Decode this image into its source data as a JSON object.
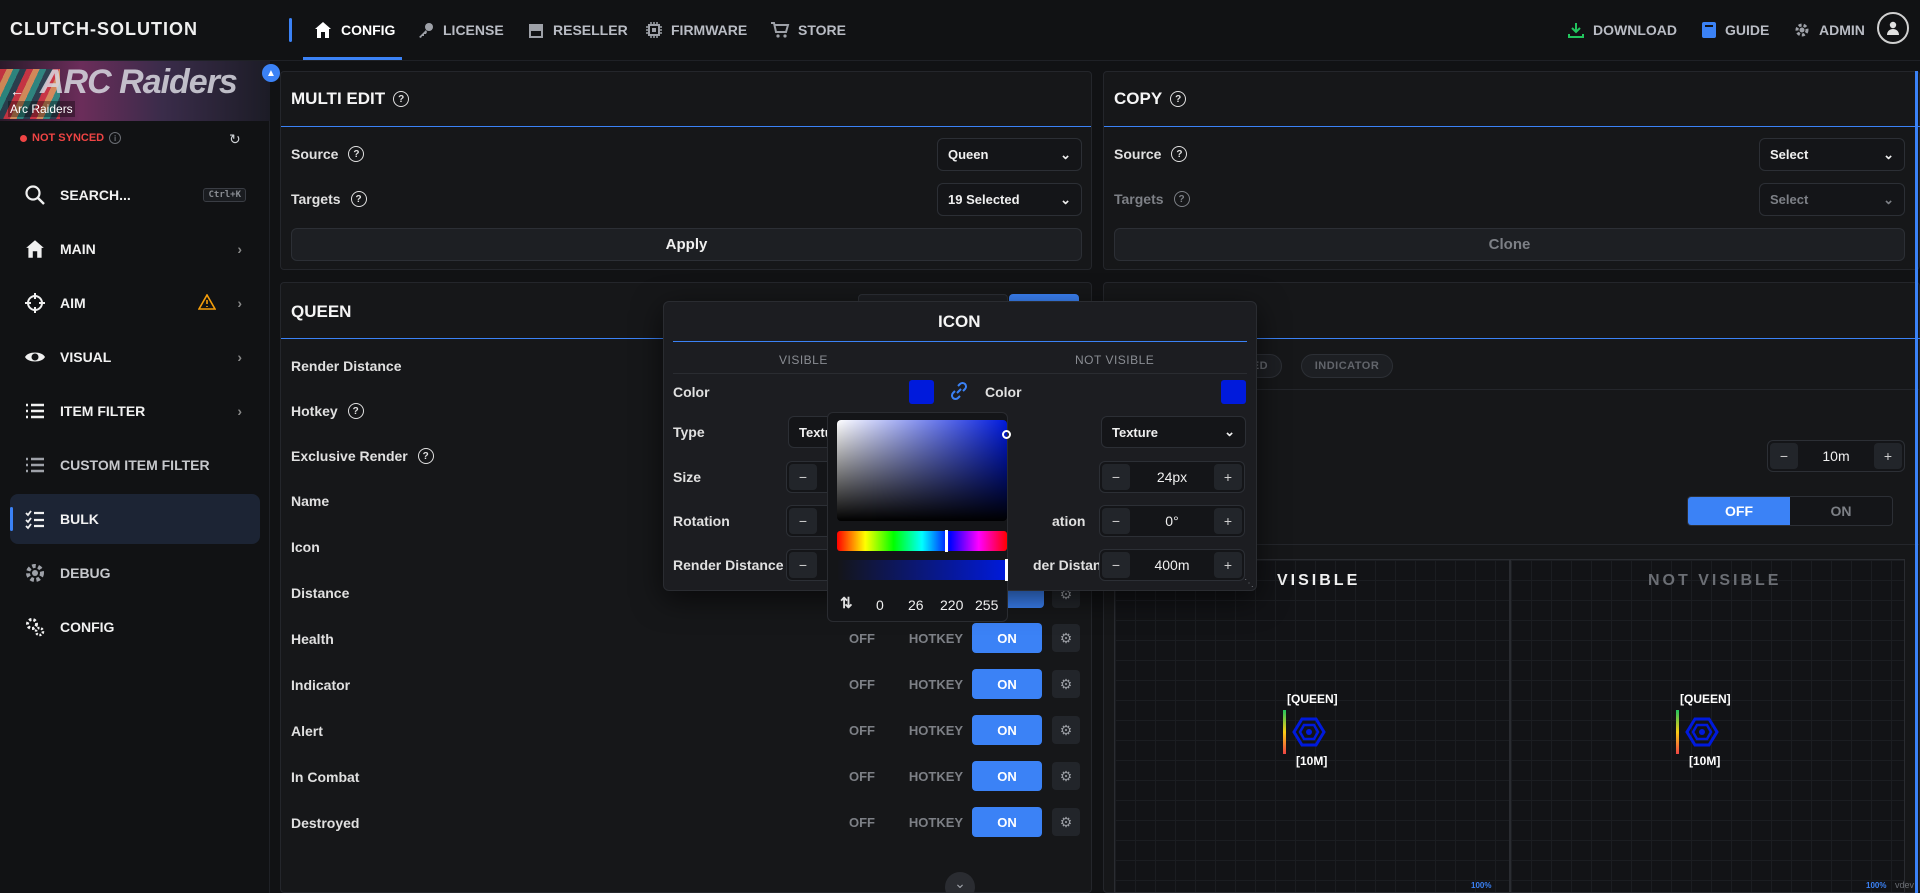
{
  "app": {
    "brand": "CLUTCH-SOLUTION"
  },
  "nav": {
    "left": [
      {
        "label": "CONFIG",
        "icon": "home-icon"
      },
      {
        "label": "LICENSE",
        "icon": "key-icon"
      },
      {
        "label": "RESELLER",
        "icon": "store-icon"
      },
      {
        "label": "FIRMWARE",
        "icon": "chip-icon"
      },
      {
        "label": "STORE",
        "icon": "cart-icon"
      }
    ],
    "right": [
      {
        "label": "DOWNLOAD",
        "icon": "download-icon"
      },
      {
        "label": "GUIDE",
        "icon": "book-icon"
      },
      {
        "label": "ADMIN",
        "icon": "gear-icon"
      }
    ]
  },
  "sidebar": {
    "game": "Arc Raiders",
    "banner_text": "ARC Raiders",
    "sync_status": "NOT SYNCED",
    "search_label": "SEARCH...",
    "search_shortcut": "Ctrl+K",
    "items": [
      {
        "label": "MAIN",
        "icon": "home-icon"
      },
      {
        "label": "AIM",
        "icon": "crosshair-icon"
      },
      {
        "label": "VISUAL",
        "icon": "eye-icon"
      },
      {
        "label": "ITEM FILTER",
        "icon": "list-icon"
      },
      {
        "label": "CUSTOM ITEM FILTER",
        "icon": "list-icon"
      },
      {
        "label": "BULK",
        "icon": "checklist-icon"
      },
      {
        "label": "DEBUG",
        "icon": "gear-icon"
      },
      {
        "label": "CONFIG",
        "icon": "gears-icon"
      }
    ]
  },
  "multi_edit": {
    "title": "MULTI EDIT",
    "source_label": "Source",
    "source_value": "Queen",
    "targets_label": "Targets",
    "targets_value": "19 Selected",
    "apply_label": "Apply"
  },
  "copy": {
    "title": "COPY",
    "source_label": "Source",
    "source_value": "Select",
    "targets_label": "Targets",
    "targets_value": "Select",
    "clone_label": "Clone"
  },
  "queen": {
    "title": "QUEEN",
    "rows": [
      {
        "label": "Render Distance"
      },
      {
        "label": "Hotkey"
      },
      {
        "label": "Exclusive Render"
      },
      {
        "label": "Name"
      },
      {
        "label": "Icon"
      },
      {
        "label": "Distance"
      },
      {
        "label": "Health"
      },
      {
        "label": "Indicator"
      },
      {
        "label": "Alert"
      },
      {
        "label": "In Combat"
      },
      {
        "label": "Destroyed"
      }
    ],
    "toggle": {
      "off": "OFF",
      "hotkey": "HOTKEY",
      "on": "ON"
    }
  },
  "right_panel": {
    "pills": [
      "YED",
      "INDICATOR"
    ],
    "distance_value": "10m",
    "seg_off": "OFF",
    "seg_on": "ON",
    "preview_visible": "VISIBLE",
    "preview_not_visible": "NOT VISIBLE",
    "tag_name": "[QUEEN]",
    "tag_distance": "[10M]",
    "zoom": "100%",
    "footer": "vdev"
  },
  "icon_popup": {
    "title": "ICON",
    "visible_header": "VISIBLE",
    "not_visible_header": "NOT VISIBLE",
    "color_label": "Color",
    "type_label": "Type",
    "type_value_visible": "Textu",
    "type_value_not_visible": "Texture",
    "size_label": "Size",
    "size_value": "24px",
    "rotation_label": "Rotation",
    "rotation_partial": "ation",
    "rotation_value": "0°",
    "render_label": "Render Distance",
    "render_partial": "der Distance",
    "render_value": "400m",
    "color_hex": "#001adc"
  },
  "color_picker": {
    "r": "0",
    "g": "26",
    "b": "220",
    "a": "255"
  }
}
